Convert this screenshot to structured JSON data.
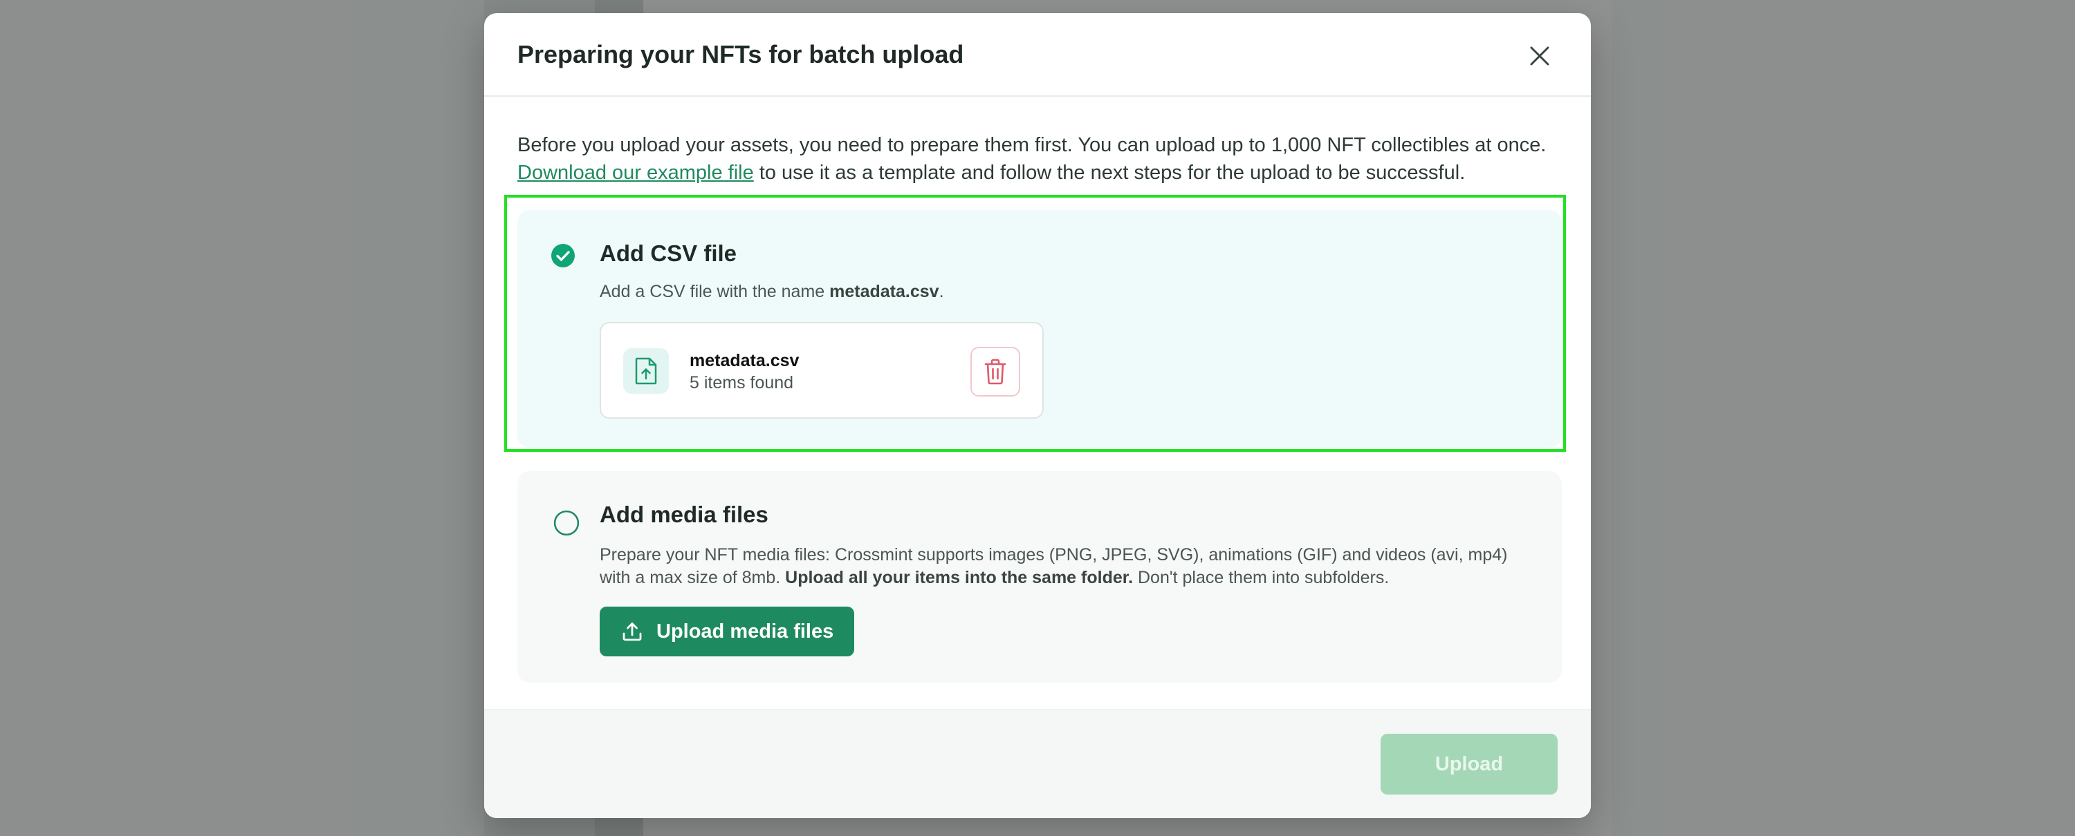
{
  "modal": {
    "title": "Preparing your NFTs for batch upload",
    "close_icon": "close-icon"
  },
  "intro": {
    "text_before": "Before you upload your assets, you need to prepare them first. You can upload up to 1,000 NFT collectibles at once. ",
    "link": "Download our example file",
    "text_after": " to use it as a template and follow the next steps for the upload to be successful."
  },
  "step_csv": {
    "title": "Add CSV file",
    "status": "completed",
    "status_icon": "check-circle-icon",
    "desc_before": "Add a CSV file with the name ",
    "desc_bold": "metadata.csv",
    "desc_after": ".",
    "file": {
      "name": "metadata.csv",
      "count": "5 items found",
      "icon": "file-upload-icon",
      "delete_icon": "trash-icon"
    }
  },
  "step_media": {
    "title": "Add media files",
    "status": "pending",
    "status_icon": "empty-circle-icon",
    "desc_before": "Prepare your NFT media files: Crossmint supports images (PNG, JPEG, SVG), animations (GIF) and videos (avi, mp4) with a max size of 8mb. ",
    "desc_bold": "Upload all your items into the same folder.",
    "desc_after": " Don't place them into subfolders.",
    "button_label": "Upload media files",
    "button_icon": "upload-icon"
  },
  "footer": {
    "upload_label": "Upload",
    "upload_enabled": false
  },
  "colors": {
    "accent": "#1e8a5f",
    "highlight": "#22e022",
    "upload_disabled": "#a3d7b5",
    "delete": "#e05a66"
  }
}
